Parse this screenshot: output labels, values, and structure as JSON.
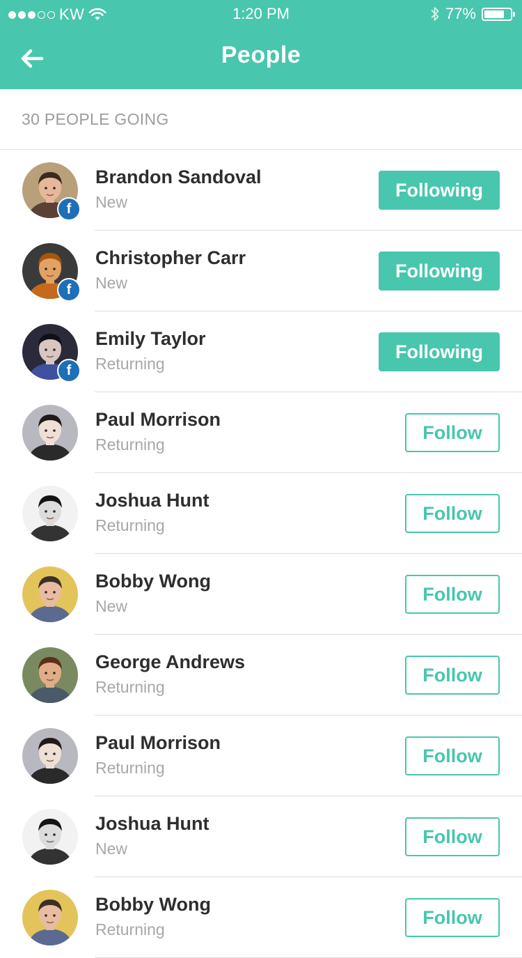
{
  "status_bar": {
    "carrier": "KW",
    "time": "1:20 PM",
    "battery": "77%",
    "battery_level": 0.77,
    "signal_bars_filled": 3,
    "signal_bars_total": 5
  },
  "nav": {
    "title": "People"
  },
  "section": {
    "header": "30 PEOPLE GOING"
  },
  "people": [
    {
      "name": "Brandon Sandoval",
      "status": "New",
      "button": "Following",
      "following": true,
      "facebook": true,
      "avatar": {
        "bg": "#b9a07a",
        "skin": "#e6b89a",
        "hair": "#3a2a20",
        "shirt": "#5a4035"
      }
    },
    {
      "name": "Christopher Carr",
      "status": "New",
      "button": "Following",
      "following": true,
      "facebook": true,
      "avatar": {
        "bg": "#3a3a3a",
        "skin": "#e2a264",
        "hair": "#a4560f",
        "shirt": "#c56a1c"
      }
    },
    {
      "name": "Emily Taylor",
      "status": "Returning",
      "button": "Following",
      "following": true,
      "facebook": true,
      "avatar": {
        "bg": "#2a2a3a",
        "skin": "#d8c6c0",
        "hair": "#101018",
        "shirt": "#4050a0"
      }
    },
    {
      "name": "Paul Morrison",
      "status": "Returning",
      "button": "Follow",
      "following": false,
      "facebook": false,
      "avatar": {
        "bg": "#b8b8c0",
        "skin": "#efe0d6",
        "hair": "#201a18",
        "shirt": "#2a2a2a"
      }
    },
    {
      "name": "Joshua Hunt",
      "status": "Returning",
      "button": "Follow",
      "following": false,
      "facebook": false,
      "avatar": {
        "bg": "#f2f2f2",
        "skin": "#dcdcdc",
        "hair": "#151515",
        "shirt": "#333333"
      }
    },
    {
      "name": "Bobby Wong",
      "status": "New",
      "button": "Follow",
      "following": false,
      "facebook": false,
      "avatar": {
        "bg": "#e3c45a",
        "skin": "#e8bca0",
        "hair": "#3a3028",
        "shirt": "#5a6a90"
      }
    },
    {
      "name": "George Andrews",
      "status": "Returning",
      "button": "Follow",
      "following": false,
      "facebook": false,
      "avatar": {
        "bg": "#7a8a60",
        "skin": "#e0ad88",
        "hair": "#5a3018",
        "shirt": "#4a5a6a"
      }
    },
    {
      "name": "Paul Morrison",
      "status": "Returning",
      "button": "Follow",
      "following": false,
      "facebook": false,
      "avatar": {
        "bg": "#b8b8c0",
        "skin": "#efe0d6",
        "hair": "#201a18",
        "shirt": "#2a2a2a"
      }
    },
    {
      "name": "Joshua Hunt",
      "status": "New",
      "button": "Follow",
      "following": false,
      "facebook": false,
      "avatar": {
        "bg": "#f2f2f2",
        "skin": "#dcdcdc",
        "hair": "#151515",
        "shirt": "#333333"
      }
    },
    {
      "name": "Bobby Wong",
      "status": "Returning",
      "button": "Follow",
      "following": false,
      "facebook": false,
      "avatar": {
        "bg": "#e3c45a",
        "skin": "#e8bca0",
        "hair": "#3a3028",
        "shirt": "#5a6a90"
      }
    }
  ],
  "colors": {
    "accent": "#48c6ae",
    "facebook": "#1d6fb8",
    "name_text": "#2e2e2e",
    "muted_text": "#a7a7a7",
    "divider": "#dddddd"
  },
  "icons": {
    "back": "arrow-left-icon",
    "wifi": "wifi-icon",
    "bluetooth": "bluetooth-icon",
    "battery": "battery-icon",
    "facebook_badge": "facebook-icon"
  }
}
